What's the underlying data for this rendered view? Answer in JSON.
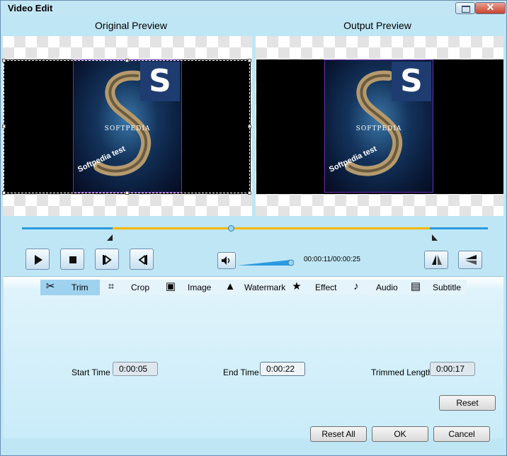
{
  "window": {
    "title": "Video Edit"
  },
  "preview": {
    "original_label": "Original Preview",
    "output_label": "Output Preview",
    "frame_caption": "SOFTPEDIA",
    "frame_badge": "S",
    "frame_watermark": "Softpedia test"
  },
  "playback": {
    "time_display": "00:00:11/00:00:25",
    "position_fraction": 0.44,
    "trim_start_fraction": 0.2,
    "trim_end_fraction": 0.88,
    "volume_fraction": 1.0,
    "accent": "#f5b800",
    "track_color": "#2a9be0"
  },
  "tabs": [
    {
      "label": "Trim",
      "icon": "scissors-icon",
      "active": true
    },
    {
      "label": "Crop",
      "icon": "crop-icon"
    },
    {
      "label": "Image",
      "icon": "image-icon"
    },
    {
      "label": "Watermark",
      "icon": "watermark-icon"
    },
    {
      "label": "Effect",
      "icon": "star-icon"
    },
    {
      "label": "Audio",
      "icon": "music-note-icon"
    },
    {
      "label": "Subtitle",
      "icon": "subtitle-icon"
    }
  ],
  "trim": {
    "start_label": "Start Time",
    "start_value": "0:00:05",
    "end_label": "End Time",
    "end_value": "0:00:22",
    "length_label": "Trimmed Length",
    "length_value": "0:00:17",
    "reset_label": "Reset"
  },
  "footer": {
    "reset_all_label": "Reset All",
    "ok_label": "OK",
    "cancel_label": "Cancel"
  }
}
